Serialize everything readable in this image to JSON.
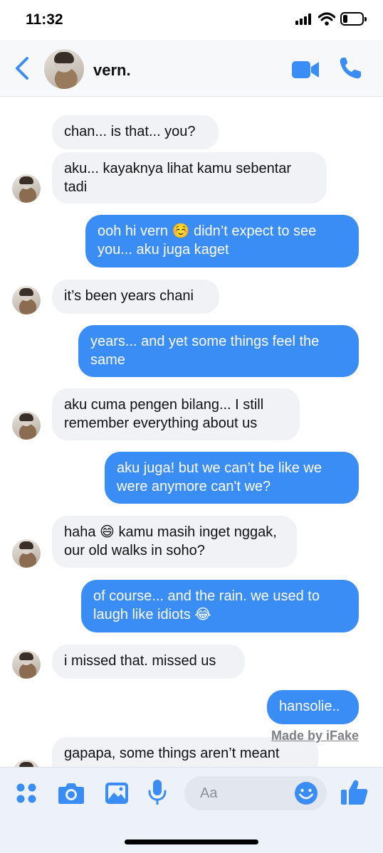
{
  "status_bar": {
    "time": "11:32"
  },
  "header": {
    "contact_name": "vern."
  },
  "messages": [
    {
      "side": "in",
      "text": "chan... is that... you?"
    },
    {
      "side": "in",
      "text": "aku... kayaknya lihat kamu sebentar\ntadi"
    },
    {
      "side": "out",
      "text": "ooh hi vern ☺️ didn’t expect to see\nyou... aku juga kaget"
    },
    {
      "side": "in",
      "text": "it’s been years chani"
    },
    {
      "side": "out",
      "text": "years... and yet some things feel the\nsame"
    },
    {
      "side": "in",
      "text": "aku cuma pengen bilang... I still\nremember everything about us"
    },
    {
      "side": "out",
      "text": "aku juga! but we can’t be like we\nwere anymore can't we?"
    },
    {
      "side": "in",
      "text": "haha 😄 kamu masih inget nggak,\nour old walks in soho?"
    },
    {
      "side": "out",
      "text": "of course... and the rain. we used to\nlaugh like idiots 😂"
    },
    {
      "side": "in",
      "text": "i missed that. missed us"
    },
    {
      "side": "out",
      "text": "hansolie.."
    },
    {
      "side": "in",
      "text": "gapapa, some things aren’t meant"
    }
  ],
  "watermark": "Made by iFake",
  "composer": {
    "placeholder": "Aa"
  },
  "colors": {
    "accent": "#3a8df5",
    "incoming_bubble": "#f1f2f5",
    "outgoing_bubble": "#3a8df5"
  },
  "icons": [
    "back-chevron-icon",
    "video-call-icon",
    "phone-call-icon",
    "apps-grid-icon",
    "camera-icon",
    "gallery-icon",
    "microphone-icon",
    "emoji-icon",
    "thumbs-up-icon"
  ]
}
